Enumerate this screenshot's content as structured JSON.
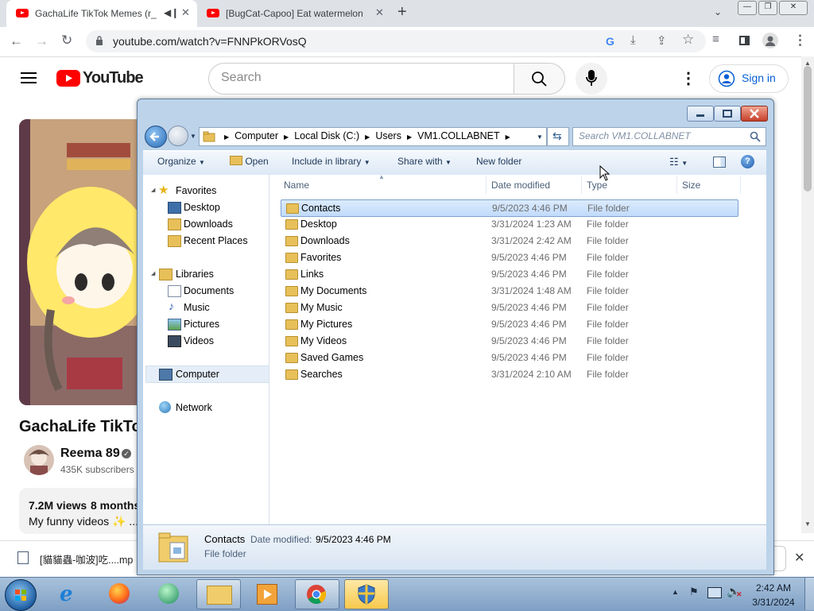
{
  "browser": {
    "tabs": [
      {
        "title": "GachaLife TikTok Memes (r_",
        "active": true
      },
      {
        "title": "[BugCat-Capoo] Eat watermelon",
        "active": false
      }
    ],
    "new_tab_label": "+",
    "url": "youtube.com/watch?v=FNNPkORVosQ"
  },
  "youtube": {
    "logo_text": "YouTube",
    "search_placeholder": "Search",
    "signin_label": "Sign in",
    "video_title": "GachaLife TikTol",
    "channel_name": "Reema 89",
    "subscribers": "435K subscribers",
    "views": "7.2M views",
    "time_ago": "8 months",
    "description": "My funny videos ✨ ...",
    "download_file": "[貓貓蟲-咖波]吃....mp"
  },
  "explorer": {
    "breadcrumb": [
      "Computer",
      "Local Disk (C:)",
      "Users",
      "VM1.COLLABNET"
    ],
    "search_placeholder": "Search VM1.COLLABNET",
    "commands": {
      "organize": "Organize",
      "open": "Open",
      "include": "Include in library",
      "share": "Share with",
      "new_folder": "New folder"
    },
    "nav": {
      "favorites": "Favorites",
      "favorites_items": [
        "Desktop",
        "Downloads",
        "Recent Places"
      ],
      "libraries": "Libraries",
      "libraries_items": [
        "Documents",
        "Music",
        "Pictures",
        "Videos"
      ],
      "computer": "Computer",
      "network": "Network"
    },
    "columns": {
      "name": "Name",
      "date": "Date modified",
      "type": "Type",
      "size": "Size"
    },
    "files": [
      {
        "name": "Contacts",
        "date": "9/5/2023 4:46 PM",
        "type": "File folder"
      },
      {
        "name": "Desktop",
        "date": "3/31/2024 1:23 AM",
        "type": "File folder"
      },
      {
        "name": "Downloads",
        "date": "3/31/2024 2:42 AM",
        "type": "File folder"
      },
      {
        "name": "Favorites",
        "date": "9/5/2023 4:46 PM",
        "type": "File folder"
      },
      {
        "name": "Links",
        "date": "9/5/2023 4:46 PM",
        "type": "File folder"
      },
      {
        "name": "My Documents",
        "date": "3/31/2024 1:48 AM",
        "type": "File folder"
      },
      {
        "name": "My Music",
        "date": "9/5/2023 4:46 PM",
        "type": "File folder"
      },
      {
        "name": "My Pictures",
        "date": "9/5/2023 4:46 PM",
        "type": "File folder"
      },
      {
        "name": "My Videos",
        "date": "9/5/2023 4:46 PM",
        "type": "File folder"
      },
      {
        "name": "Saved Games",
        "date": "9/5/2023 4:46 PM",
        "type": "File folder"
      },
      {
        "name": "Searches",
        "date": "3/31/2024 2:10 AM",
        "type": "File folder"
      }
    ],
    "selected_index": 0,
    "details": {
      "name": "Contacts",
      "date_label": "Date modified:",
      "date": "9/5/2023 4:46 PM",
      "type": "File folder"
    }
  },
  "taskbar": {
    "time": "2:42 AM",
    "date": "3/31/2024",
    "apps": [
      "start-orb",
      "internet-explorer",
      "firefox",
      "media-center",
      "windows-explorer",
      "media-player",
      "chrome",
      "security-shield"
    ]
  }
}
